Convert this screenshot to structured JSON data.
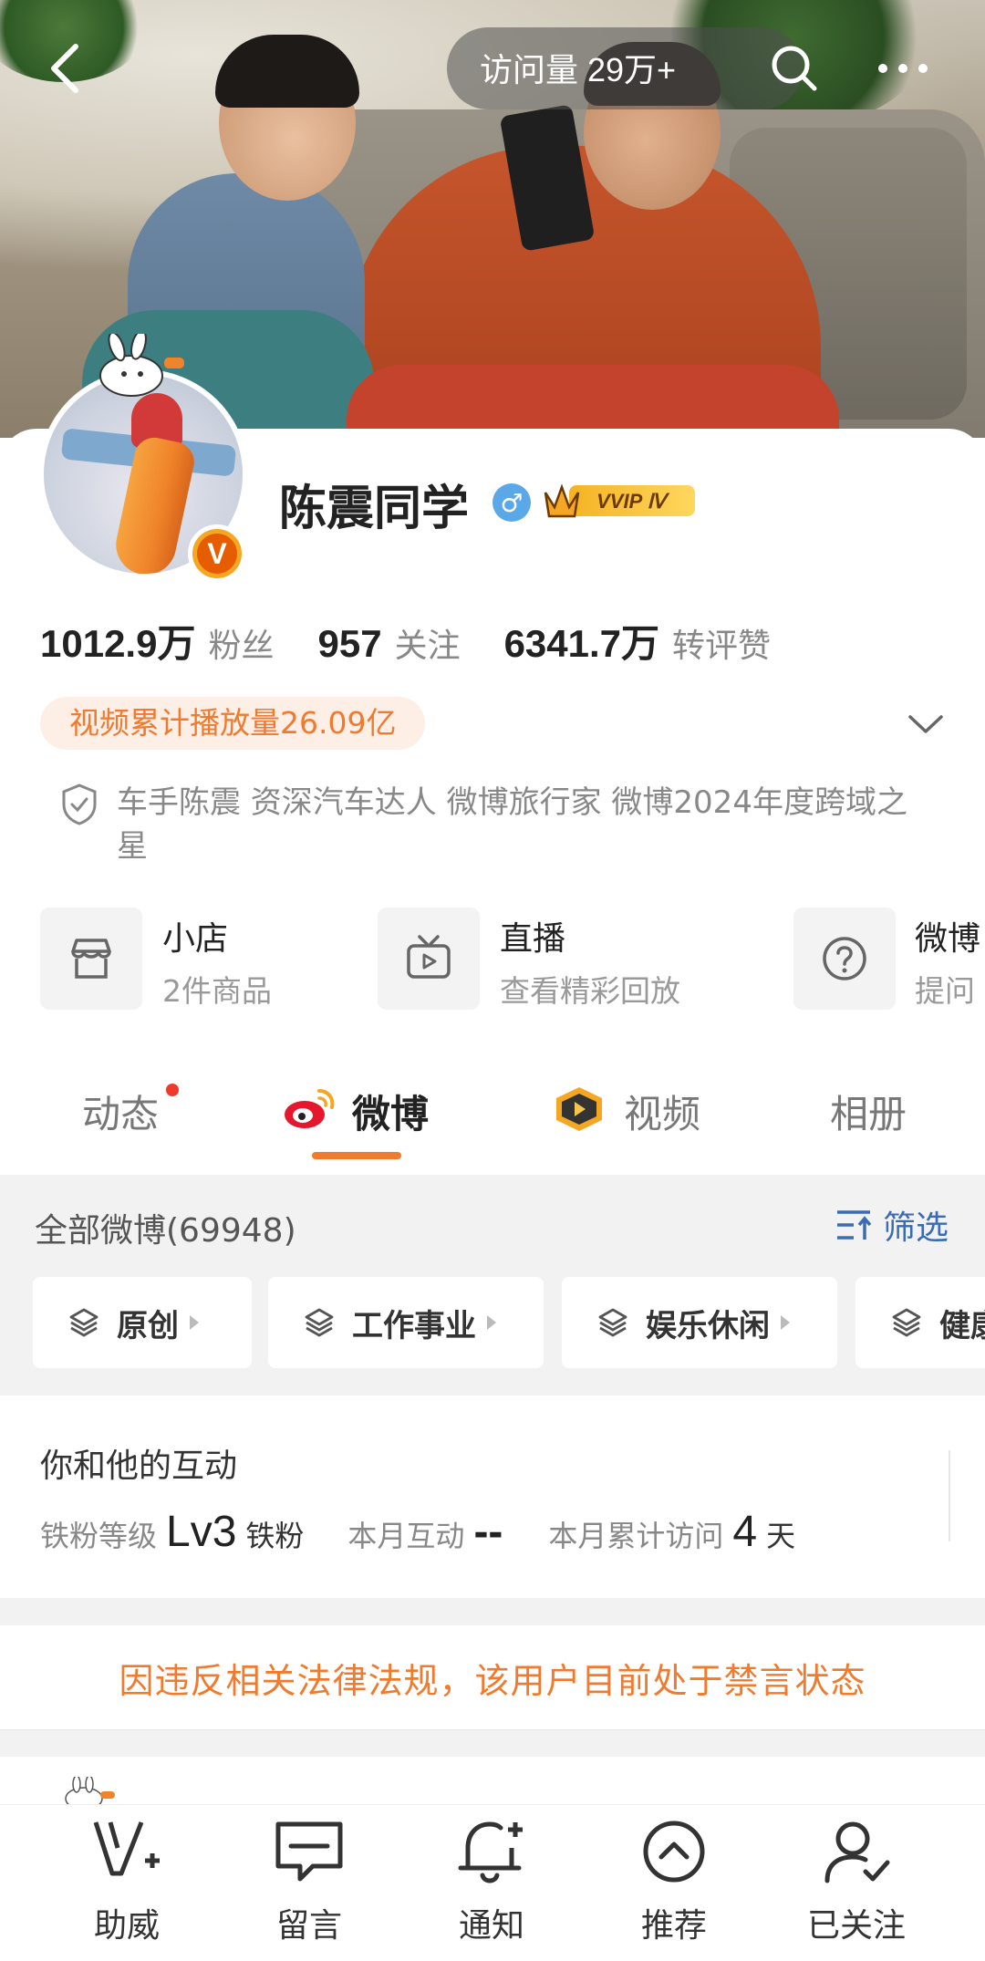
{
  "header": {
    "visit_label": "访问量 29万+",
    "icons": {
      "back": "back-arrow-icon",
      "search": "search-icon",
      "more": "more-dots-icon"
    }
  },
  "profile": {
    "name": "陈震同学",
    "gender_symbol": "♂",
    "vip_badge": "VVIP Ⅳ",
    "verified_mark": "V",
    "stats": [
      {
        "value": "1012.9万",
        "label": "粉丝"
      },
      {
        "value": "957",
        "label": "关注"
      },
      {
        "value": "6341.7万",
        "label": "转评赞"
      }
    ],
    "video_play_count": "视频累计播放量26.09亿",
    "certification": "车手陈震 资深汽车达人  微博旅行家 微博2024年度跨域之星"
  },
  "shortcuts": [
    {
      "title": "小店",
      "subtitle": "2件商品",
      "icon": "shop-icon"
    },
    {
      "title": "直播",
      "subtitle": "查看精彩回放",
      "icon": "tv-icon"
    },
    {
      "title": "微博",
      "subtitle": "提问",
      "icon": "question-icon"
    }
  ],
  "tabs": [
    {
      "label": "动态",
      "has_dot": true
    },
    {
      "label": "微博",
      "active": true
    },
    {
      "label": "视频"
    },
    {
      "label": "相册"
    }
  ],
  "feed": {
    "all_label": "全部微博(69948)",
    "filter_label": "筛选",
    "chips": [
      "原创",
      "工作事业",
      "娱乐休闲",
      "健康"
    ]
  },
  "interaction": {
    "title": "你和他的互动",
    "fan_level_label": "铁粉等级",
    "fan_level_value": "Lv3",
    "fan_level_unit": "铁粉",
    "month_interact_label": "本月互动",
    "month_interact_value": "--",
    "month_visit_label": "本月累计访问",
    "month_visit_value": "4",
    "month_visit_unit": "天"
  },
  "ban_notice": "因违反相关法律法规，该用户目前处于禁言状态",
  "bottom_nav": [
    {
      "label": "助威",
      "icon": "cheer-v-icon"
    },
    {
      "label": "留言",
      "icon": "message-icon"
    },
    {
      "label": "通知",
      "icon": "bell-plus-icon"
    },
    {
      "label": "推荐",
      "icon": "recommend-up-icon"
    },
    {
      "label": "已关注",
      "icon": "user-check-icon"
    }
  ],
  "colors": {
    "accent": "#f07a2e",
    "filter_blue": "#3a6bb5",
    "gender_blue": "#5ba8e8"
  }
}
